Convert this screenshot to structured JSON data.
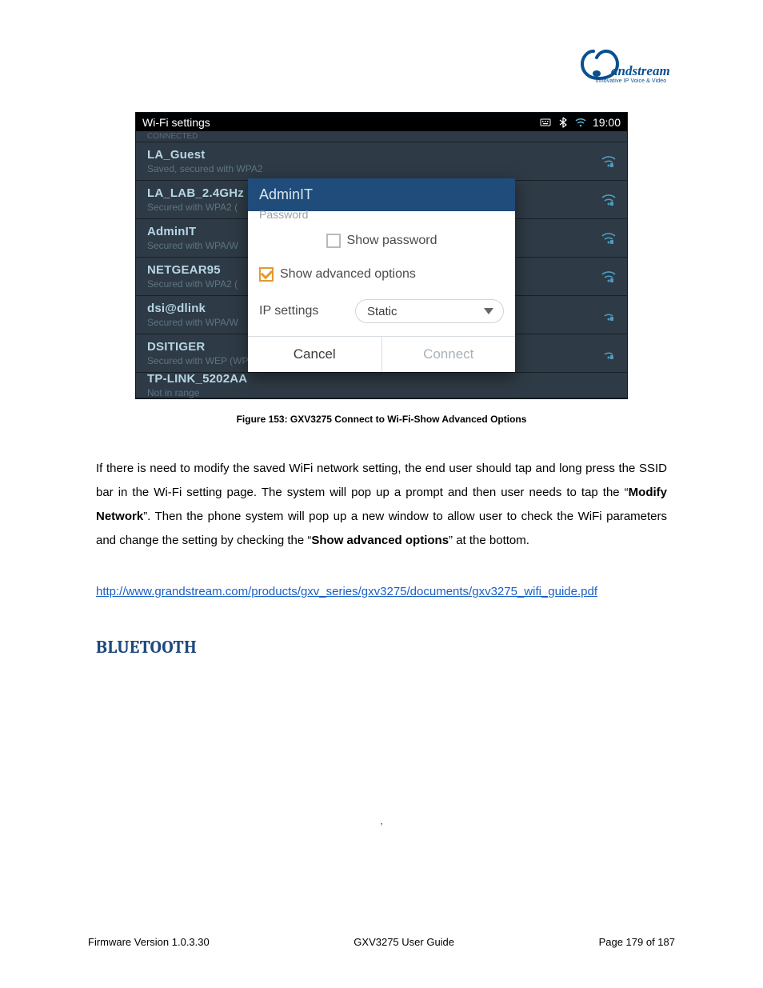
{
  "logo": {
    "brand": "Grandstream",
    "tagline": "Innovative IP Voice & Video"
  },
  "screenshot": {
    "statusbar": {
      "title": "Wi-Fi settings",
      "time": "19:00"
    },
    "top_cut_text": "CONNECTED",
    "networks": [
      {
        "ssid": "LA_Guest",
        "sub": "Saved, secured with WPA2"
      },
      {
        "ssid": "LA_LAB_2.4GHz",
        "sub": "Secured with WPA2 ("
      },
      {
        "ssid": "AdminIT",
        "sub": "Secured with WPA/W"
      },
      {
        "ssid": "NETGEAR95",
        "sub": "Secured with WPA2 ("
      },
      {
        "ssid": "dsi@dlink",
        "sub": "Secured with WPA/W"
      },
      {
        "ssid": "DSITIGER",
        "sub": "Secured with WEP (WPS available)"
      },
      {
        "ssid": "TP-LINK_5202AA",
        "sub": "Not in range"
      }
    ],
    "dialog": {
      "title": "AdminIT",
      "password_label": "Password",
      "show_password": "Show password",
      "show_advanced": "Show advanced options",
      "ip_settings_label": "IP settings",
      "ip_settings_value": "Static",
      "cancel": "Cancel",
      "connect": "Connect"
    }
  },
  "caption": "Figure 153: GXV3275 Connect to Wi-Fi-Show Advanced Options",
  "paragraph": {
    "p1a": "If there is need to modify the saved WiFi network setting, the end user should tap and long press the SSID bar in the Wi-Fi setting page. The system will pop up a prompt and then user needs to tap the “",
    "p1b": "Modify Network",
    "p1c": "”. Then the phone system will pop up a new window to allow user to check the WiFi parameters and change the setting by checking the “",
    "p1d": "Show advanced options",
    "p1e": "” at the bottom."
  },
  "link_text": "http://www.grandstream.com/products/gxv_series/gxv3275/documents/gxv3275_wifi_guide.pdf",
  "section_heading": "BLUETOOTH",
  "tick_mark": ",",
  "footer": {
    "left": "Firmware Version 1.0.3.30",
    "center": "GXV3275 User Guide",
    "right": "Page 179 of 187"
  }
}
